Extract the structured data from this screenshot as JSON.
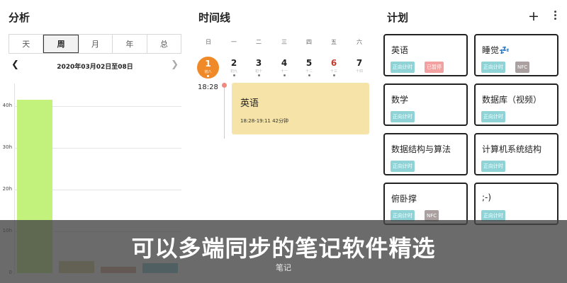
{
  "analysis": {
    "title": "分析",
    "periods": [
      "天",
      "周",
      "月",
      "年",
      "总"
    ],
    "active_period": 1,
    "date_range": "2020年03月02日至08日",
    "y_ticks": [
      "40h",
      "30h",
      "20h",
      "10h",
      "0"
    ]
  },
  "chart_data": {
    "type": "bar",
    "ylim": [
      0,
      45
    ],
    "ylabel": "",
    "xlabel": "",
    "y_ticks": [
      0,
      10,
      20,
      30,
      40
    ],
    "values": [
      41.5,
      2.8,
      1.6,
      2.4
    ],
    "colors": [
      "#c2f27c",
      "#d6c98e",
      "#d4a08a",
      "#7bc6d0"
    ]
  },
  "timeline": {
    "title": "时间线",
    "weekdays": [
      "日",
      "一",
      "二",
      "三",
      "四",
      "五",
      "六"
    ],
    "days": [
      {
        "num": "1",
        "sub": "初八"
      },
      {
        "num": "2",
        "sub": "初九"
      },
      {
        "num": "3",
        "sub": "初十"
      },
      {
        "num": "4",
        "sub": "十一"
      },
      {
        "num": "5",
        "sub": "十二"
      },
      {
        "num": "6",
        "sub": "十三"
      },
      {
        "num": "7",
        "sub": "十四"
      }
    ],
    "event": {
      "time": "18:28",
      "title": "英语",
      "detail": "18:28-19:11 42分钟"
    }
  },
  "plan": {
    "title": "计划",
    "add_icon": "plus-icon",
    "more_icon": "more-vertical-icon",
    "items": [
      {
        "name": "英语",
        "tags": [
          "正向计时",
          "已暂停"
        ]
      },
      {
        "name": "睡觉💤",
        "tags": [
          "正向计时",
          "NFC"
        ]
      },
      {
        "name": "数学",
        "tags": [
          "正向计时"
        ]
      },
      {
        "name": "数据库（视频）",
        "tags": [
          "正向计时"
        ]
      },
      {
        "name": "数据结构与算法",
        "tags": [
          "正向计时"
        ]
      },
      {
        "name": "计算机系统结构",
        "tags": [
          "正向计时"
        ]
      },
      {
        "name": "俯卧撑",
        "tags": [
          "正向计时",
          "NFC"
        ]
      },
      {
        "name": ";-)",
        "tags": [
          "正向计时"
        ]
      }
    ],
    "tag_colors": {
      "正向计时": "#8fd3d6",
      "已暂停": "#f2a0a0",
      "NFC": "#aaa0a0"
    }
  },
  "overlay": {
    "headline": "可以多端同步的笔记软件精选",
    "caption": "笔记"
  }
}
